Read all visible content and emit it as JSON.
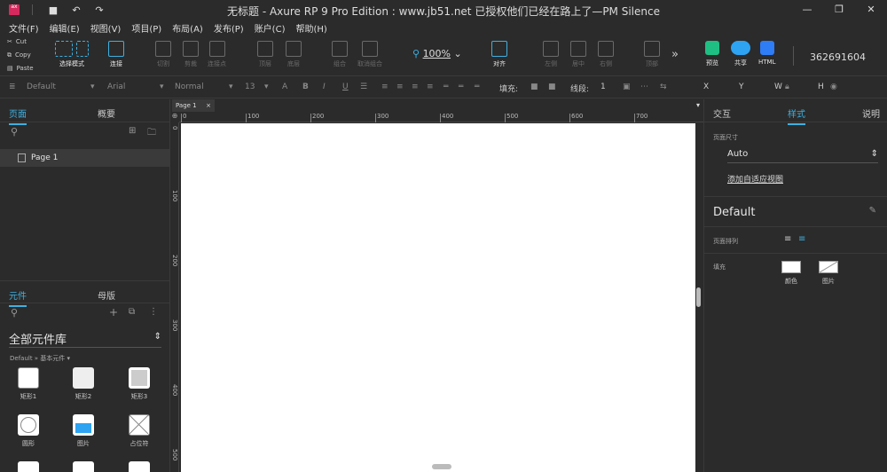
{
  "titlebar": {
    "logo_text": "ax",
    "title": "无标题 - Axure RP 9 Pro Edition : www.jb51.net 已授权他们已经在路上了—PM Silence",
    "icons": [
      "save-icon",
      "undo-icon",
      "redo-icon"
    ],
    "controls": [
      "minimize-icon",
      "maximize-icon",
      "close-icon"
    ]
  },
  "menu": [
    "文件(F)",
    "编辑(E)",
    "视图(V)",
    "项目(P)",
    "布局(A)",
    "发布(P)",
    "账户(C)",
    "帮助(H)"
  ],
  "toolbar": {
    "clipboard": [
      "Cut",
      "Copy",
      "Paste"
    ],
    "select_mode": "选择模式",
    "connect": "连接",
    "cut": "切割",
    "crop": "剪裁",
    "connect_point": "连接点",
    "top": "顶层",
    "bottom": "底层",
    "group": "组合",
    "ungroup": "取消组合",
    "zoom": "100%",
    "align": "对齐",
    "left": "左侧",
    "center": "居中",
    "right": "右侧",
    "top_align": "顶部",
    "more": "»",
    "preview": "预览",
    "share": "共享",
    "html": "HTML",
    "account": "362691604"
  },
  "formatbar": {
    "style": "Default",
    "font": "Arial",
    "weight": "Normal",
    "size": "13",
    "fill_label": "填充:",
    "stroke_label": "线段:",
    "stroke_value": "1",
    "x": "X",
    "y": "Y",
    "w": "W",
    "h": "H"
  },
  "left": {
    "tab_pages": "页面",
    "tab_outline": "概要",
    "page_item": "Page 1",
    "tab_widgets": "元件",
    "tab_masters": "母版",
    "library": "全部元件库",
    "breadcrumb": "Default » 基本元件 ▾",
    "widgets": [
      "矩形1",
      "矩形2",
      "矩形3",
      "圆形",
      "图片",
      "占位符"
    ]
  },
  "canvas": {
    "page_tab": "Page 1",
    "ruler_top": [
      "0",
      "100",
      "200",
      "300",
      "400",
      "500",
      "600",
      "700"
    ],
    "ruler_left": [
      "0",
      "100",
      "200",
      "300",
      "400",
      "500"
    ]
  },
  "right": {
    "tab_interact": "交互",
    "tab_style": "样式",
    "tab_notes": "说明",
    "page_size_label": "页面尺寸",
    "page_size_value": "Auto",
    "adaptive_link": "添加自适应视图",
    "style_name": "Default",
    "page_align_label": "页面排列",
    "fill_label": "填充",
    "fill_color": "颜色",
    "fill_image": "图片"
  }
}
